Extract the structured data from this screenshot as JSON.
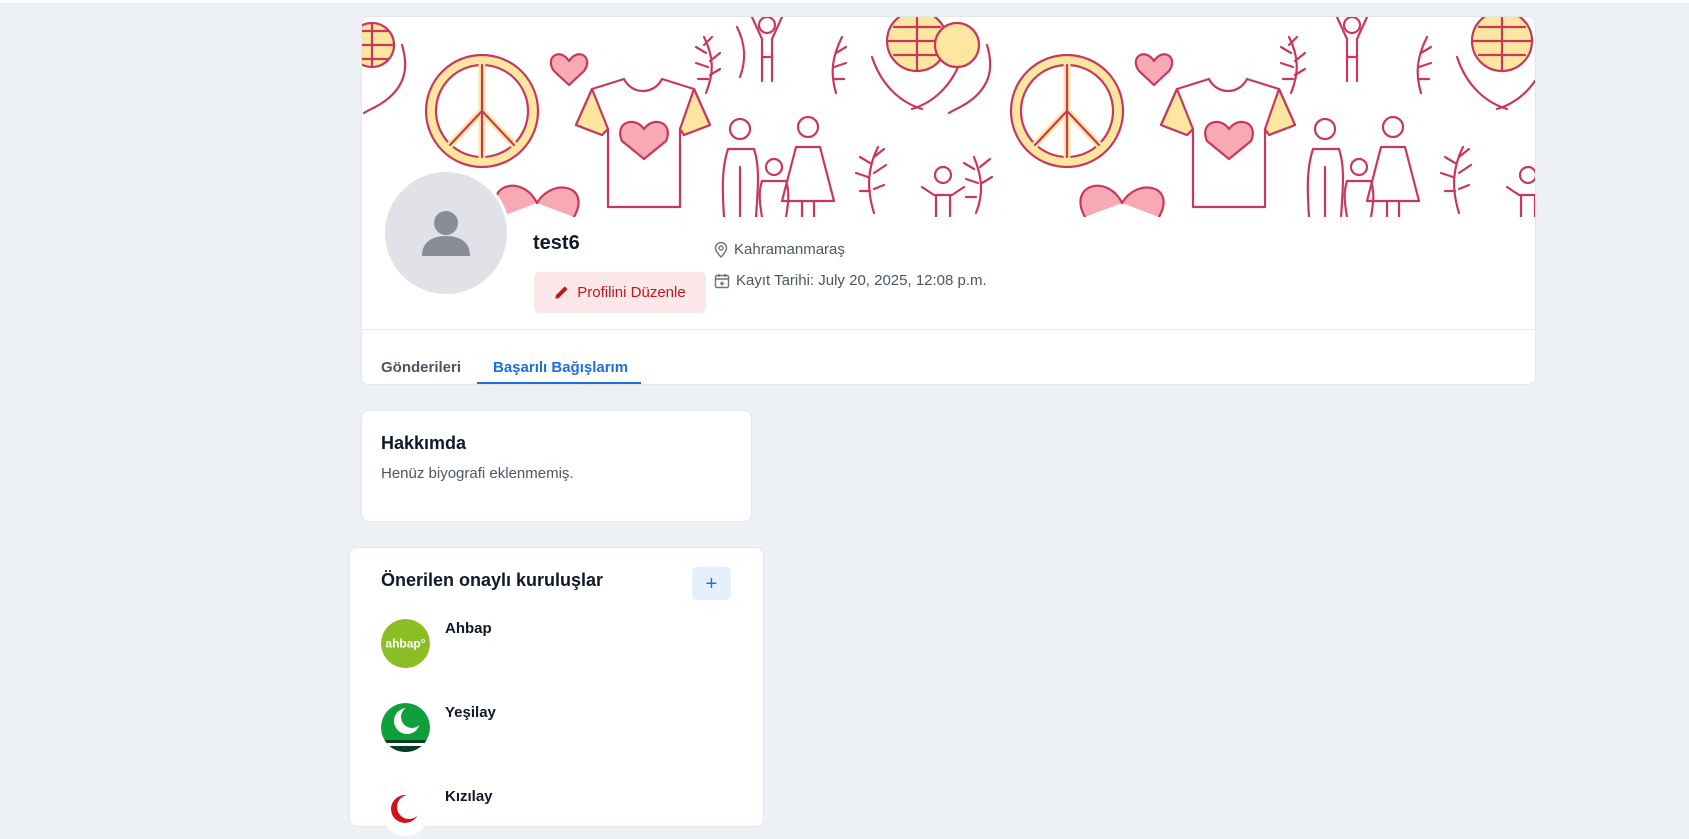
{
  "profile": {
    "username": "test6",
    "edit_label": "Profilini Düzenle",
    "location": "Kahramanmaraş",
    "join_date": "Kayıt Tarihi: July 20, 2025, 12:08 p.m."
  },
  "tabs": [
    {
      "label": "Gönderileri",
      "active": false
    },
    {
      "label": "Başarılı Bağışlarım",
      "active": true
    }
  ],
  "about": {
    "title": "Hakkımda",
    "text": "Henüz biyografi eklenmemiş."
  },
  "suggested_orgs": {
    "title": "Önerilen onaylı kuruluşlar",
    "add_label": "+",
    "items": [
      {
        "name": "Ahbap",
        "logo_text": "ahbap°",
        "color": "#8bbd24"
      },
      {
        "name": "Yeşilay",
        "color": "#0f9f3c"
      },
      {
        "name": "Kızılay",
        "color": "#d0121b"
      }
    ]
  },
  "colors": {
    "accent": "#1d6fe0",
    "danger": "#c4161c",
    "danger_bg": "#fce7e9",
    "page_bg": "#edf0f5",
    "cover_line": "#c9385c",
    "cover_fill_yellow": "#fde7a0",
    "cover_fill_pink": "#f7a9b4"
  }
}
